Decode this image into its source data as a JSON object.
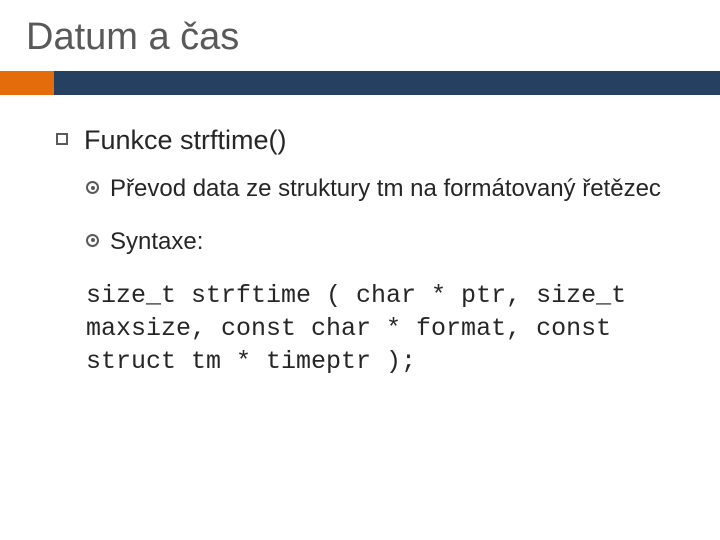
{
  "title": "Datum a čas",
  "heading": "Funkce strftime()",
  "desc": "Převod data ze struktury tm na formátovaný řetězec",
  "syntax_label": "Syntaxe:",
  "code": "size_t strftime ( char * ptr, size_t maxsize, const char * format, const struct tm * timeptr );"
}
